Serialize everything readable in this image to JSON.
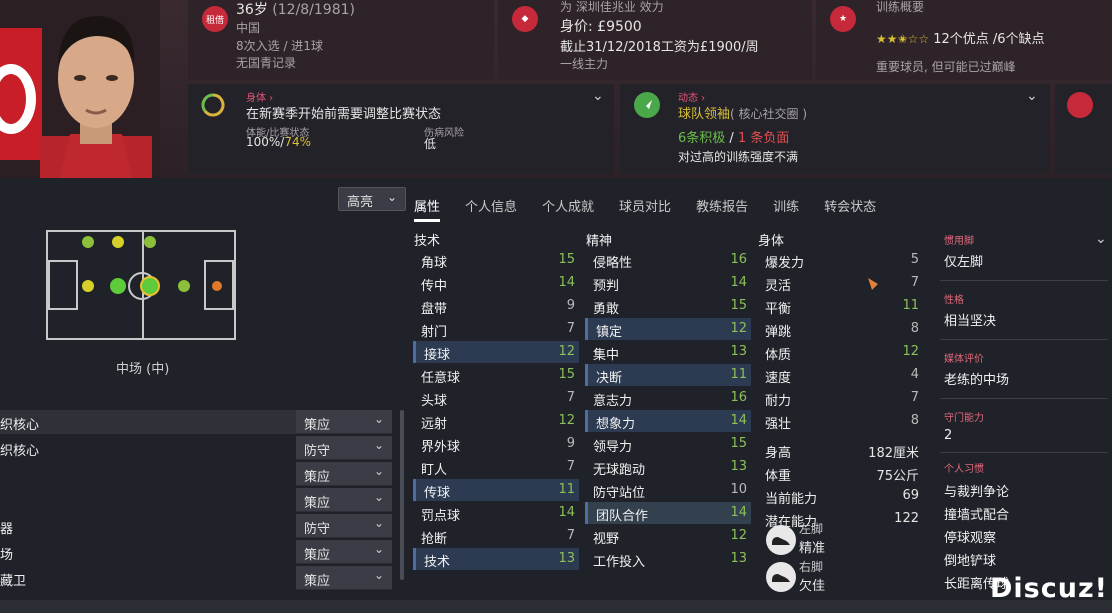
{
  "header": {
    "age_line": "36岁",
    "dob": "(12/8/1981)",
    "loan_badge": "租借",
    "nation": "中国",
    "caps": "8次入选 / 进1球",
    "youth": "无国青记录",
    "club_line": "为 深圳佳兆业 效力",
    "value_label": "身价: ",
    "value": "£9500",
    "contract": "截止31/12/2018工资为£1900/周",
    "squad_status": "一线主力",
    "training_title": "训练概要",
    "stars_rating": "★★✬☆☆",
    "traits": "12个优点 /6个缺点",
    "training_note": "重要球员, 但可能已过巅峰"
  },
  "cards": {
    "body_tag": "身体 ›",
    "body_title": "在新赛季开始前需要调整比赛状态",
    "fitness_label": "体能/比赛状态",
    "fitness_val_a": "100%/",
    "fitness_val_b": "74%",
    "injury_label": "伤病风险",
    "injury_val": "低",
    "dyn_tag": "动态 ›",
    "dyn_title": "球队领袖",
    "dyn_sub": "( 核心社交圈 )",
    "pos_count": "6条积极",
    "slash": " / ",
    "neg_count": "1 条负面",
    "dyn_note": "对过高的训练强度不满"
  },
  "pitch": {
    "position_label": "中场 (中)"
  },
  "highlight_dropdown": "高亮",
  "tabs": [
    "属性",
    "个人信息",
    "个人成就",
    "球员对比",
    "教练报告",
    "训练",
    "转会状态"
  ],
  "columns": {
    "technical": "技术",
    "mental": "精神",
    "physical": "身体"
  },
  "technical": [
    {
      "name": "角球",
      "value": "15"
    },
    {
      "name": "传中",
      "value": "14"
    },
    {
      "name": "盘带",
      "value": "9"
    },
    {
      "name": "射门",
      "value": "7"
    },
    {
      "name": "接球",
      "value": "12"
    },
    {
      "name": "任意球",
      "value": "15"
    },
    {
      "name": "头球",
      "value": "7"
    },
    {
      "name": "远射",
      "value": "12"
    },
    {
      "name": "界外球",
      "value": "9"
    },
    {
      "name": "盯人",
      "value": "7"
    },
    {
      "name": "传球",
      "value": "11"
    },
    {
      "name": "罚点球",
      "value": "14"
    },
    {
      "name": "抢断",
      "value": "7"
    },
    {
      "name": "技术",
      "value": "13"
    }
  ],
  "mental": [
    {
      "name": "侵略性",
      "value": "16"
    },
    {
      "name": "预判",
      "value": "14"
    },
    {
      "name": "勇敢",
      "value": "15"
    },
    {
      "name": "镇定",
      "value": "12"
    },
    {
      "name": "集中",
      "value": "13"
    },
    {
      "name": "决断",
      "value": "11"
    },
    {
      "name": "意志力",
      "value": "16"
    },
    {
      "name": "想象力",
      "value": "14"
    },
    {
      "name": "领导力",
      "value": "15"
    },
    {
      "name": "无球跑动",
      "value": "13"
    },
    {
      "name": "防守站位",
      "value": "10"
    },
    {
      "name": "团队合作",
      "value": "14"
    },
    {
      "name": "视野",
      "value": "12"
    },
    {
      "name": "工作投入",
      "value": "13"
    }
  ],
  "physical": [
    {
      "name": "爆发力",
      "value": "5"
    },
    {
      "name": "灵活",
      "value": "7"
    },
    {
      "name": "平衡",
      "value": "11"
    },
    {
      "name": "弹跳",
      "value": "8"
    },
    {
      "name": "体质",
      "value": "12"
    },
    {
      "name": "速度",
      "value": "4"
    },
    {
      "name": "耐力",
      "value": "7"
    },
    {
      "name": "强壮",
      "value": "8"
    }
  ],
  "physical_stats": [
    {
      "name": "身高",
      "value": "182厘米"
    },
    {
      "name": "体重",
      "value": "75公斤"
    },
    {
      "name": "当前能力",
      "value": "69"
    },
    {
      "name": "潜在能力",
      "value": "122"
    }
  ],
  "feet": {
    "left_label": "左脚",
    "left_val": "精准",
    "right_label": "右脚",
    "right_val": "欠佳"
  },
  "roles": [
    {
      "name": "织核心",
      "duty": "策应"
    },
    {
      "name": "织核心",
      "duty": "防守"
    },
    {
      "name": "",
      "duty": "策应"
    },
    {
      "name": "",
      "duty": "策应"
    },
    {
      "name": "器",
      "duty": "防守"
    },
    {
      "name": "场",
      "duty": "策应"
    },
    {
      "name": "藏卫",
      "duty": "策应"
    }
  ],
  "info": {
    "foot_label": "惯用脚",
    "foot_val": "仅左脚",
    "personality_label": "性格",
    "personality_val": "相当坚决",
    "media_label": "媒体评价",
    "media_val": "老练的中场",
    "gk_label": "守门能力",
    "gk_val": "2",
    "habits_label": "个人习惯",
    "habits": [
      "与裁判争论",
      "撞墙式配合",
      "停球观察",
      "倒地铲球",
      "长距离传球"
    ]
  },
  "watermark": "Discuz!",
  "colors": {
    "accent_red": "#c62a3a",
    "green": "#6dbe4a",
    "highlight_row": "#2c3b52"
  }
}
